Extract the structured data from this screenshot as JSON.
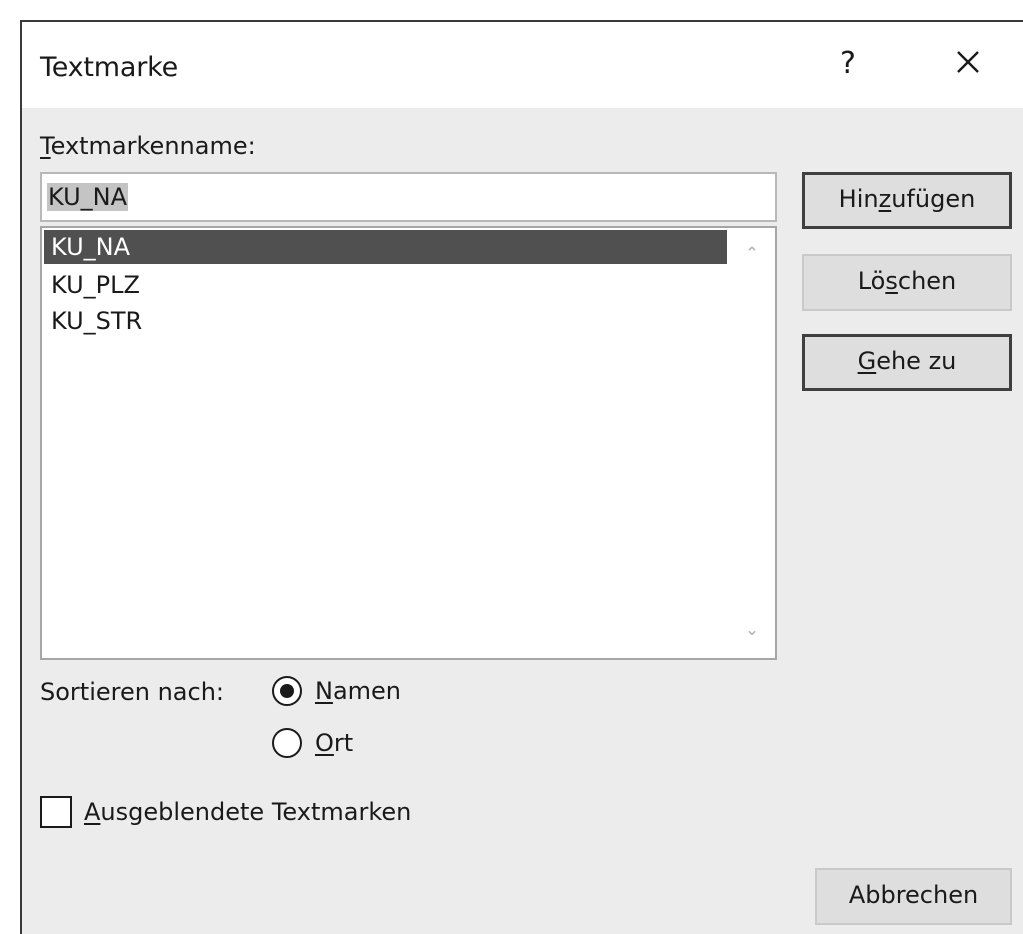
{
  "dialog": {
    "title": "Textmarke",
    "help_glyph": "?",
    "close_icon": "close-icon"
  },
  "name_field": {
    "label": "Textmarkenname:",
    "value": "KU_NA"
  },
  "bookmarks": {
    "items": [
      "KU_NA",
      "KU_PLZ",
      "KU_STR"
    ],
    "selected_index": 0
  },
  "buttons": {
    "add": "Hinzufügen",
    "delete": "Löschen",
    "goto": "Gehe zu",
    "cancel": "Abbrechen"
  },
  "sort": {
    "label": "Sortieren nach:",
    "options": [
      "Namen",
      "Ort"
    ],
    "selected": "Namen"
  },
  "hidden_bookmarks": {
    "label": "Ausgeblendete Textmarken",
    "checked": false
  },
  "colors": {
    "dialog_bg": "#ececec",
    "selection_bg": "#505050",
    "titlebar_bg": "#ffffff"
  }
}
